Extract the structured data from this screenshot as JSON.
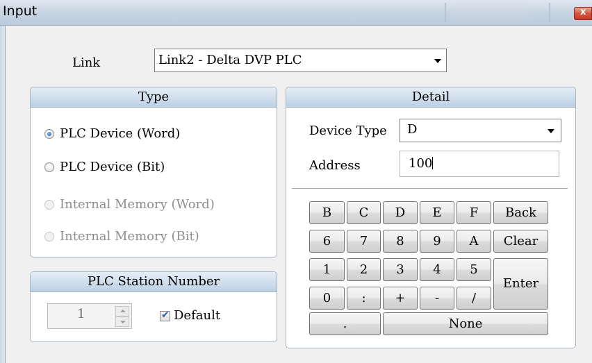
{
  "window": {
    "title": "Input"
  },
  "link": {
    "label": "Link",
    "value": "Link2 - Delta DVP PLC"
  },
  "type_group": {
    "title": "Type",
    "options": [
      {
        "label": "PLC Device (Word)",
        "checked": true,
        "enabled": true
      },
      {
        "label": "PLC Device (Bit)",
        "checked": false,
        "enabled": true
      },
      {
        "label": "Internal Memory (Word)",
        "checked": false,
        "enabled": false
      },
      {
        "label": "Internal Memory (Bit)",
        "checked": false,
        "enabled": false
      }
    ]
  },
  "station": {
    "title": "PLC Station Number",
    "value": "1",
    "default_label": "Default",
    "default_checked": true
  },
  "detail": {
    "title": "Detail",
    "device_type_label": "Device Type",
    "device_type_value": "D",
    "address_label": "Address",
    "address_value": "100"
  },
  "keypad": {
    "row1": [
      "B",
      "C",
      "D",
      "E",
      "F",
      "Back"
    ],
    "row2": [
      "6",
      "7",
      "8",
      "9",
      "A",
      "Clear"
    ],
    "row3": [
      "1",
      "2",
      "3",
      "4",
      "5"
    ],
    "row4": [
      "0",
      ":",
      "+",
      "-",
      "/"
    ],
    "enter": "Enter",
    "dot": ".",
    "none": "None"
  }
}
